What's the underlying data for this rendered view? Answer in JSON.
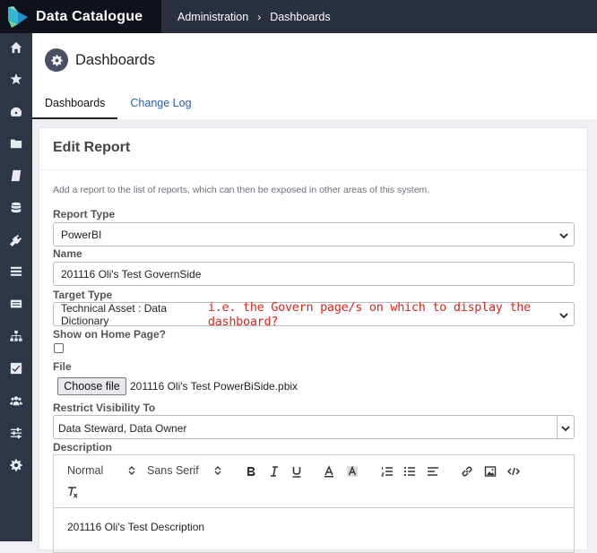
{
  "app": {
    "title": "Data Catalogue"
  },
  "breadcrumb": [
    "Administration",
    "Dashboards"
  ],
  "sidebar": [
    "home-icon",
    "star-icon",
    "dashboard-icon",
    "folder-icon",
    "book-icon",
    "database-icon",
    "plug-icon",
    "list-icon",
    "id-card-icon",
    "sitemap-icon",
    "check-square-icon",
    "users-icon",
    "sliders-icon",
    "gear-icon"
  ],
  "page": {
    "title": "Dashboards"
  },
  "tabs": [
    {
      "label": "Dashboards",
      "active": true
    },
    {
      "label": "Change Log",
      "active": false
    }
  ],
  "form": {
    "heading": "Edit Report",
    "description": "Add a report to the list of reports, which can then be exposed in other areas of this system.",
    "report_type": {
      "label": "Report Type",
      "value": "PowerBI"
    },
    "name": {
      "label": "Name",
      "value": "201116 Oli's Test GovernSide"
    },
    "target_type": {
      "label": "Target Type",
      "value": "Technical Asset : Data Dictionary",
      "note": "i.e. the Govern page/s on which to display the dashboard?"
    },
    "show_on_home": {
      "label": "Show on Home Page?",
      "checked": false
    },
    "file": {
      "label": "File",
      "button": "Choose file",
      "filename": "201116 Oli's Test PowerBiSide.pbix"
    },
    "restrict": {
      "label": "Restrict Visibility To",
      "value": "Data Steward, Data Owner"
    },
    "description_field": {
      "label": "Description",
      "toolbar": {
        "format": "Normal",
        "font": "Sans Serif"
      },
      "content": "201116 Oli's Test Description"
    }
  },
  "colors": {
    "topbar": "#2b3041",
    "brand": "#0f121a",
    "sidebar": "#2e3547",
    "link": "#2a5db0",
    "note": "#e0241c"
  }
}
